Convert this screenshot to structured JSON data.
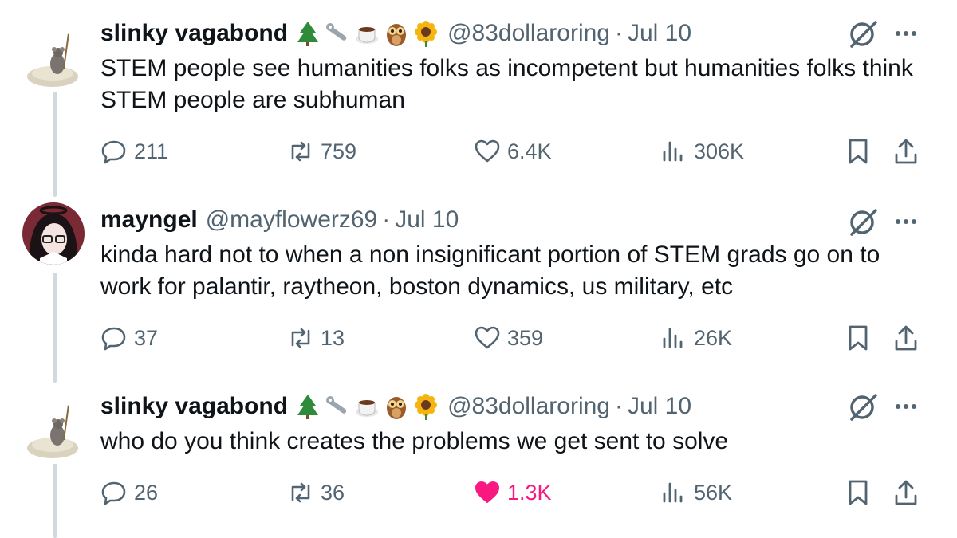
{
  "tweets": [
    {
      "name": "slinky vagabond",
      "emojis": [
        "tree-emoji",
        "wrench-emoji",
        "coffee-emoji",
        "owl-emoji",
        "sunflower-emoji"
      ],
      "handle": "@83dollaroring",
      "dot": "·",
      "date": "Jul 10",
      "text": "STEM people see humanities folks as incompetent but humanities folks think STEM people are subhuman",
      "replies": "211",
      "reposts": "759",
      "likes": "6.4K",
      "views": "306K",
      "liked": false
    },
    {
      "name": "mayngel",
      "emojis": [],
      "handle": "@mayflowerz69",
      "dot": "·",
      "date": "Jul 10",
      "text": "kinda hard not to when a non insignificant portion of STEM grads go on to work for palantir, raytheon, boston dynamics, us military, etc",
      "replies": "37",
      "reposts": "13",
      "likes": "359",
      "views": "26K",
      "liked": false
    },
    {
      "name": "slinky vagabond",
      "emojis": [
        "tree-emoji",
        "wrench-emoji",
        "coffee-emoji",
        "owl-emoji",
        "sunflower-emoji"
      ],
      "handle": "@83dollaroring",
      "dot": "·",
      "date": "Jul 10",
      "text": "who do you think creates the problems we get sent to solve",
      "replies": "26",
      "reposts": "36",
      "likes": "1.3K",
      "views": "56K",
      "liked": true
    }
  ],
  "colors": {
    "text": "#0f1419",
    "secondary": "#536471",
    "like_active": "#f91880",
    "thread_line": "#cfd9de"
  }
}
